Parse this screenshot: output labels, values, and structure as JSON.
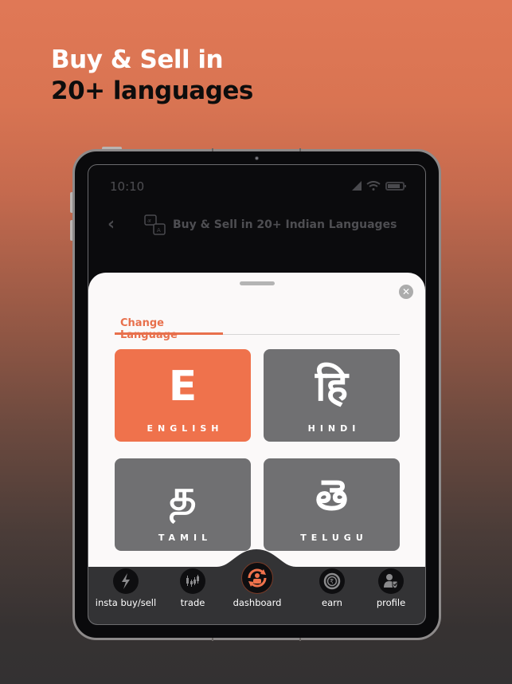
{
  "promo": {
    "headline_line1": "Buy & Sell in",
    "headline_line2": "20+ languages"
  },
  "status_bar": {
    "time": "10:10",
    "icons": [
      "signal-icon",
      "wifi-icon",
      "battery-icon"
    ]
  },
  "app_bar": {
    "back_icon": "chevron-left-icon",
    "title_icon": "translate-icon",
    "title": "Buy & Sell in 20+ Indian Languages"
  },
  "sheet": {
    "close_icon": "close-icon",
    "tab_label": "Change Language",
    "languages": [
      {
        "glyph": "E",
        "name": "ENGLISH",
        "selected": true
      },
      {
        "glyph": "हि",
        "name": "HINDI",
        "selected": false
      },
      {
        "glyph": "த",
        "name": "TAMIL",
        "selected": false
      },
      {
        "glyph": "తె",
        "name": "TELUGU",
        "selected": false
      }
    ]
  },
  "bottom_nav": {
    "items": [
      {
        "label": "insta buy/sell",
        "icon": "lightning-icon"
      },
      {
        "label": "trade",
        "icon": "candlestick-icon"
      },
      {
        "label": "dashboard",
        "icon": "dashboard-user-icon",
        "active": true
      },
      {
        "label": "earn",
        "icon": "rupee-coin-icon"
      },
      {
        "label": "profile",
        "icon": "user-shield-icon"
      }
    ]
  },
  "colors": {
    "accent": "#ef724c",
    "card_inactive": "#707072",
    "nav_bg": "#333335",
    "sheet_bg": "#fbf9f9"
  }
}
